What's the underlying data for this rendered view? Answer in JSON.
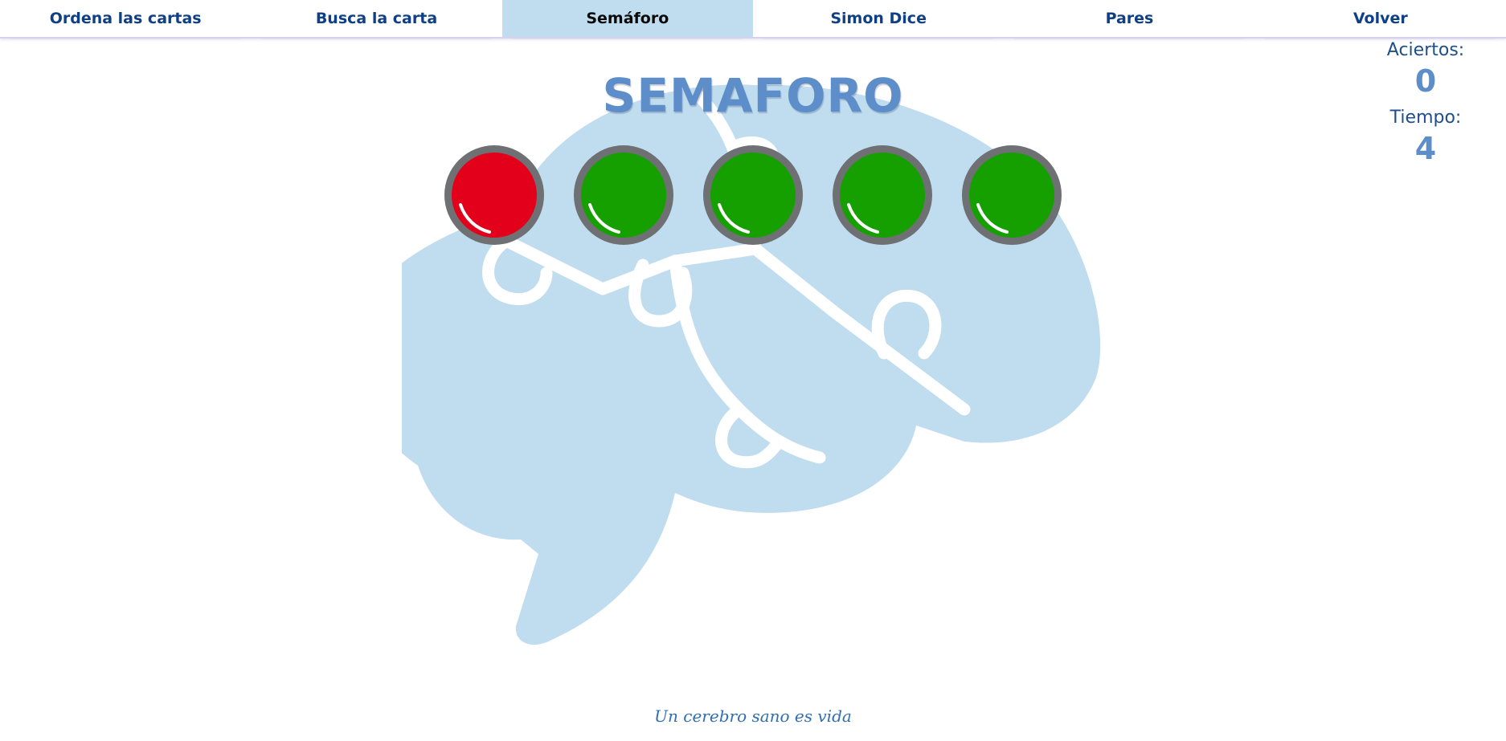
{
  "nav": {
    "tabs": [
      {
        "label": "Ordena las cartas",
        "active": false
      },
      {
        "label": "Busca la carta",
        "active": false
      },
      {
        "label": "Semáforo",
        "active": true
      },
      {
        "label": "Simon Dice",
        "active": false
      },
      {
        "label": "Pares",
        "active": false
      },
      {
        "label": "Volver",
        "active": false
      }
    ]
  },
  "game": {
    "title": "SEMAFORO",
    "lights": [
      {
        "color": "red"
      },
      {
        "color": "green"
      },
      {
        "color": "green"
      },
      {
        "color": "green"
      },
      {
        "color": "green"
      }
    ]
  },
  "score": {
    "hits_label": "Aciertos:",
    "hits_value": "0",
    "time_label": "Tiempo:",
    "time_value": "4"
  },
  "footer": {
    "tagline": "Un cerebro sano es vida"
  },
  "colors": {
    "accent": "#5d8ec9",
    "nav_text": "#0f3f86",
    "active_tab_bg": "#c0dcef",
    "brain": "#c0dcef",
    "light_red": "#e2001a",
    "light_green": "#15a000",
    "light_ring": "#6e7073"
  }
}
